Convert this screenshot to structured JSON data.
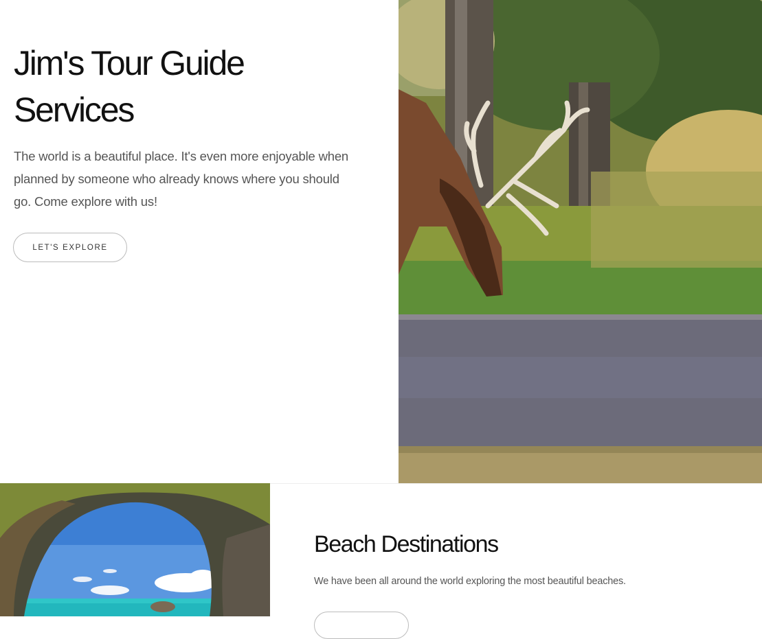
{
  "hero": {
    "title_line1": "Jim's Tour Guide",
    "title_line2": "Services",
    "description": "The world is a beautiful place. It's even more enjoyable when planned by someone who already knows where you should go. Come explore with us!",
    "button_label": "LET'S EXPLORE"
  },
  "beach": {
    "title": "Beach Destinations",
    "description": "We have been all around the world exploring the most beautiful beaches.",
    "button_label": ""
  }
}
